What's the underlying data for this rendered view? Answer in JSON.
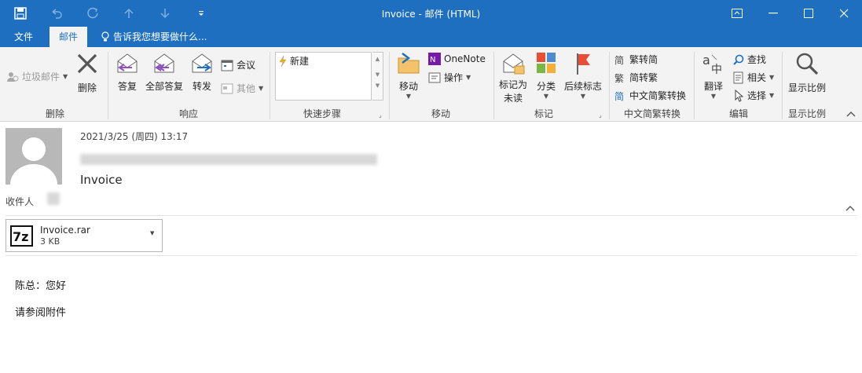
{
  "window": {
    "title": "Invoice - 邮件 (HTML)",
    "controls": [
      "restore-ribbon",
      "minimize",
      "maximize",
      "close"
    ]
  },
  "tabs": {
    "file": "文件",
    "message": "邮件",
    "tell_me": "告诉我您想要做什么..."
  },
  "ribbon": {
    "delete_group": {
      "junk": "垃圾邮件",
      "delete": "删除",
      "label": "删除"
    },
    "respond_group": {
      "reply": "答复",
      "reply_all": "全部答复",
      "forward": "转发",
      "meeting": "会议",
      "more": "其他",
      "label": "响应"
    },
    "quick_steps_group": {
      "new": "新建",
      "label": "快速步骤"
    },
    "move_group": {
      "move": "移动",
      "onenote": "OneNote",
      "actions": "操作",
      "label": "移动"
    },
    "tags_group": {
      "mark_unread_line1": "标记为",
      "mark_unread_line2": "未读",
      "categorize": "分类",
      "follow_up": "后续标志",
      "label": "标记"
    },
    "chinese_group": {
      "to_simplified": "繁转简",
      "to_traditional": "简转繁",
      "convert": "中文简繁转换",
      "label": "中文简繁转换"
    },
    "editing_group": {
      "translate": "翻译",
      "find": "查找",
      "related": "相关",
      "select": "选择",
      "label": "编辑"
    },
    "zoom_group": {
      "zoom": "显示比例",
      "label": "显示比例"
    }
  },
  "message": {
    "date": "2021/3/25 (周四) 13:17",
    "subject": "Invoice",
    "to_label": "收件人",
    "attachment": {
      "name": "Invoice.rar",
      "size": "3 KB",
      "icon": "7z-icon"
    },
    "body": [
      "陈总：您好",
      "请参阅附件"
    ]
  },
  "colors": {
    "accent": "#1e6fc0",
    "ribbon_bg": "#f3f3f3"
  }
}
